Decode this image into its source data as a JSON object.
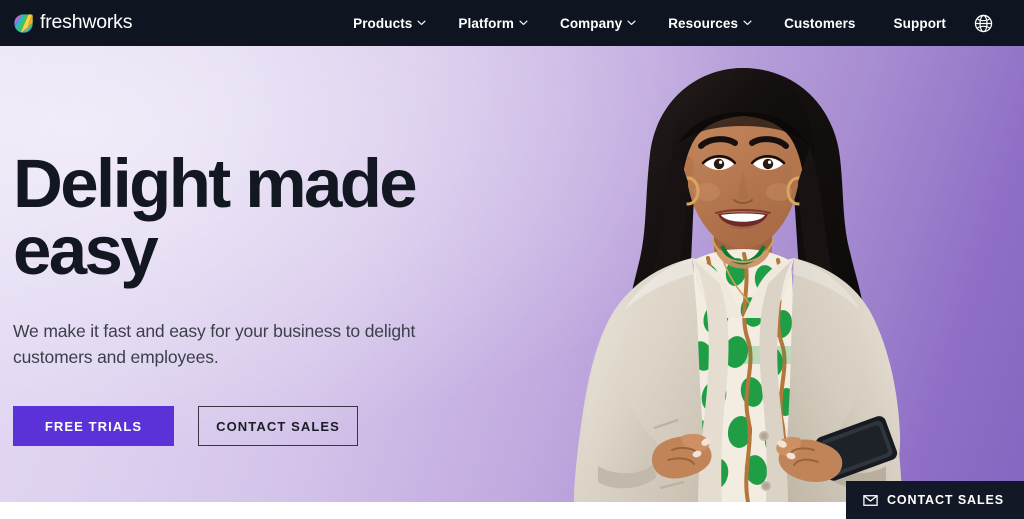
{
  "brand": {
    "name": "freshworks",
    "logo_icon": "freshworks-leaf-logo",
    "logo_colors": [
      "#e84c8a",
      "#f5a623",
      "#ffd23f",
      "#3fbf6f",
      "#2bb5c9",
      "#5a7fd8"
    ]
  },
  "nav": {
    "items": [
      {
        "label": "Products",
        "has_dropdown": true,
        "icon": "chevron-down-icon"
      },
      {
        "label": "Platform",
        "has_dropdown": true,
        "icon": "chevron-down-icon"
      },
      {
        "label": "Company",
        "has_dropdown": true,
        "icon": "chevron-down-icon"
      },
      {
        "label": "Resources",
        "has_dropdown": true,
        "icon": "chevron-down-icon"
      },
      {
        "label": "Customers",
        "has_dropdown": false,
        "icon": ""
      },
      {
        "label": "Support",
        "has_dropdown": false,
        "icon": ""
      }
    ],
    "language_icon": "globe-icon",
    "background_color": "#0e1420"
  },
  "hero": {
    "headline_line1": "Delight made",
    "headline_line2": "easy",
    "subhead": "We make it fast and easy for your business to delight customers and employees.",
    "primary_cta": "FREE TRIALS",
    "secondary_cta": "CONTACT SALES",
    "primary_cta_color": "#5a32d8",
    "headline_color": "#121722",
    "gradient_from": "#e3d9f3",
    "gradient_to": "#8466c0",
    "photo_alt": "smiling-businesswoman-in-beige-blazer-holding-phone"
  },
  "floating": {
    "contact_label": "CONTACT SALES",
    "contact_icon": "envelope-icon",
    "background_color": "#121826"
  }
}
